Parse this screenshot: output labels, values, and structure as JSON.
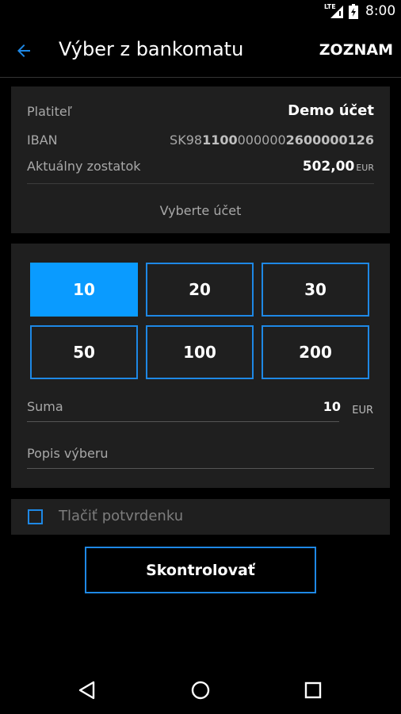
{
  "status": {
    "network": "LTE",
    "time": "8:00"
  },
  "header": {
    "title": "Výber z bankomatu",
    "action": "ZOZNAM"
  },
  "account": {
    "payer_label": "Platiteľ",
    "payer_value": "Demo účet",
    "iban_label": "IBAN",
    "iban_parts": [
      "SK98",
      "1100",
      "000000",
      "2600000126"
    ],
    "balance_label": "Aktuálny zostatok",
    "balance_value": "502,00",
    "balance_currency": "EUR",
    "select_label": "Vyberte účet"
  },
  "amounts": {
    "options": [
      "10",
      "20",
      "30",
      "50",
      "100",
      "200"
    ],
    "selected": "10"
  },
  "sum": {
    "label": "Suma",
    "value": "10",
    "currency": "EUR"
  },
  "description": {
    "placeholder": "Popis výberu"
  },
  "receipt": {
    "label": "Tlačiť potvrdenku",
    "checked": false
  },
  "confirm_label": "Skontrolovať",
  "colors": {
    "accent": "#1e88e5",
    "selected": "#0a9bff",
    "card": "#1f1f1f",
    "background": "#000000"
  },
  "icons": [
    "back-arrow-icon",
    "signal-icon",
    "battery-icon",
    "nav-back-icon",
    "nav-home-icon",
    "nav-recent-icon"
  ]
}
